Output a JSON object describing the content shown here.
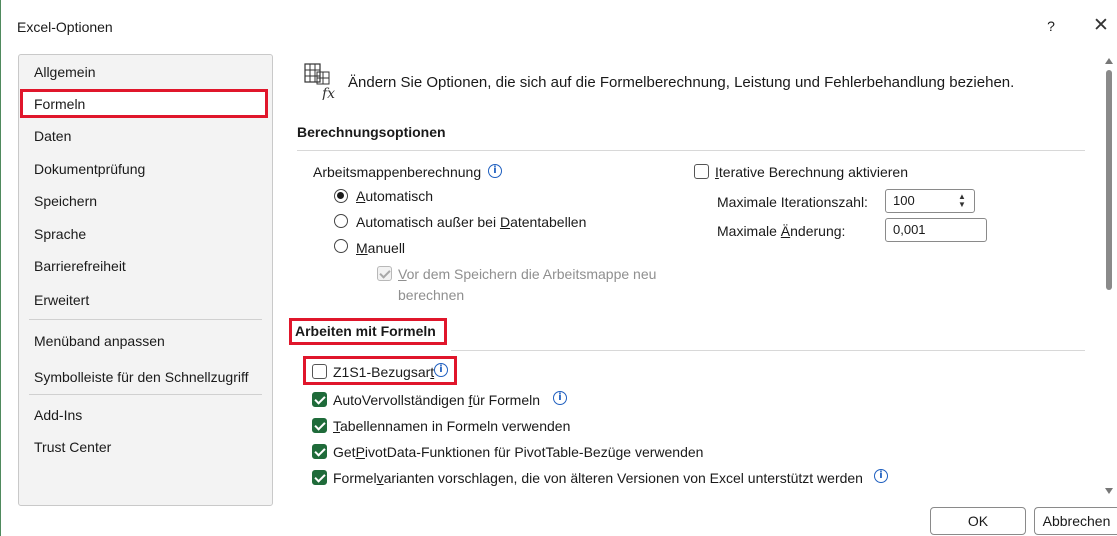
{
  "window": {
    "title": "Excel-Optionen",
    "help_label": "?",
    "close_label": "✕"
  },
  "sidebar": {
    "items": [
      {
        "label": "Allgemein"
      },
      {
        "label": "Formeln"
      },
      {
        "label": "Daten"
      },
      {
        "label": "Dokumentprüfung"
      },
      {
        "label": "Speichern"
      },
      {
        "label": "Sprache"
      },
      {
        "label": "Barrierefreiheit"
      },
      {
        "label": "Erweitert"
      },
      {
        "label": "Menüband anpassen"
      },
      {
        "label": "Symbolleiste für den Schnellzugriff"
      },
      {
        "label": "Add-Ins"
      },
      {
        "label": "Trust Center"
      }
    ],
    "selected": "Formeln"
  },
  "main": {
    "heading": "Ändern Sie Optionen, die sich auf die Formelberechnung, Leistung und Fehlerbehandlung beziehen.",
    "calc": {
      "title": "Berechnungsoptionen",
      "workbook_label": "Arbeitsmappenberechnung",
      "radio_auto_a": "A",
      "radio_auto_b": "utomatisch",
      "radio_except_a": "Automatisch außer bei ",
      "radio_except_b": "D",
      "radio_except_c": "atentabellen",
      "radio_manual_a": "M",
      "radio_manual_b": "anuell",
      "recalc_line1_a": "V",
      "recalc_line1_b": "or dem Speichern die Arbeitsmappe neu",
      "recalc_line2": "berechnen",
      "iterative_a": "I",
      "iterative_b": "terative Berechnung aktivieren",
      "max_iter_label": "Maximale Iterationszahl:",
      "max_iter_value": "100",
      "max_change_a": "Maximale ",
      "max_change_b": "Ä",
      "max_change_c": "nderung:",
      "max_change_value": "0,001"
    },
    "formulas": {
      "title": "Arbeiten mit Formeln",
      "r1c1_a": "Z1S1-Bezugsar",
      "r1c1_b": "t",
      "autocomplete_a": "AutoVervollständigen ",
      "autocomplete_b": "f",
      "autocomplete_c": "ür Formeln",
      "tablenames_a": "T",
      "tablenames_b": "abellennamen in Formeln verwenden",
      "getpivot_a": "Get",
      "getpivot_b": "P",
      "getpivot_c": "ivotData-Funktionen für PivotTable-Bezüge verwenden",
      "variants_a": "Formel",
      "variants_b": "v",
      "variants_c": "arianten vorschlagen, die von älteren Versionen von Excel unterstützt werden"
    }
  },
  "footer": {
    "ok": "OK",
    "cancel": "Abbrechen"
  },
  "colors": {
    "highlight": "#e0162b",
    "checkbox_checked": "#1f6b3a",
    "info": "#1f5fbf"
  },
  "icons": [
    "formula-icon",
    "info-icon",
    "close-icon",
    "scroll-up-icon",
    "scroll-down-icon"
  ]
}
